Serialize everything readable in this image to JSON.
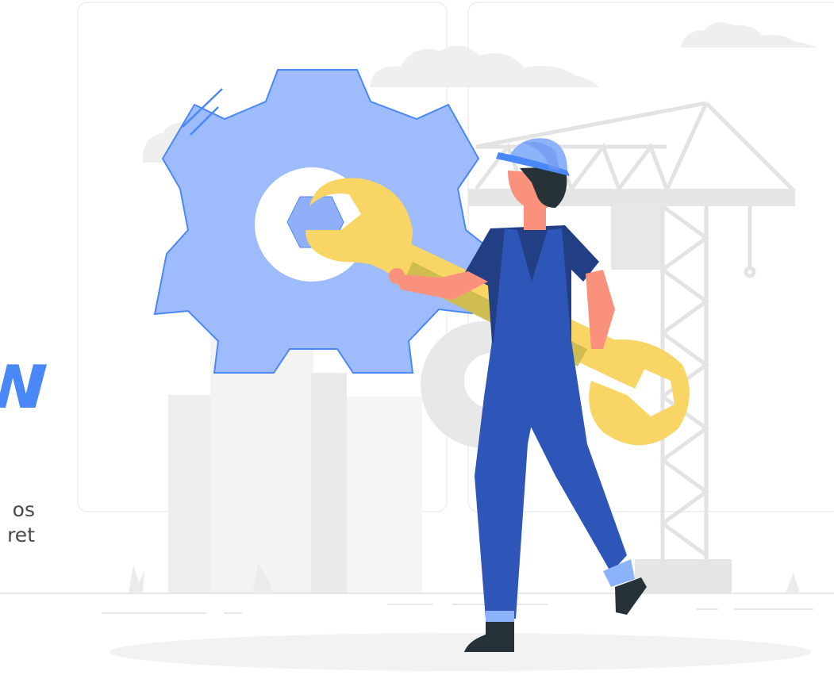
{
  "headline_fragment": "w",
  "paragraph_fragment": [
    "os",
    "ret"
  ],
  "colors": {
    "accent": "#4a88f7",
    "gear": "#9ebbfb",
    "gear_stroke": "#4a88f7",
    "wrench": "#f8d565",
    "worker_overalls": "#2d56b8",
    "worker_shirt": "#223f86",
    "skin": "#f9917c",
    "hair": "#263238",
    "helmet": "#8cb2fa",
    "background_shapes": "#ececec",
    "text": "#4a4a4a"
  },
  "illustration": {
    "subject": "worker-with-wrench-and-gear",
    "elements": [
      "background-panel",
      "cloud",
      "crane",
      "building",
      "large-gear",
      "worker",
      "wrench",
      "ground-shadow"
    ]
  }
}
